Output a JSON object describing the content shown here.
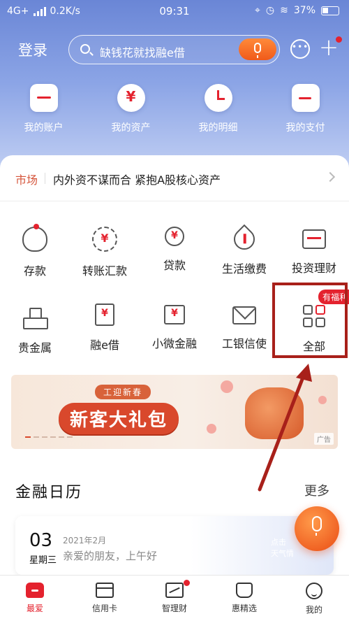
{
  "status_bar": {
    "network": "4G+",
    "speed": "0.2K/s",
    "time": "09:31",
    "battery": "37%"
  },
  "header": {
    "login_label": "登录",
    "search_placeholder": "缺钱花就找融e借"
  },
  "quick_actions": [
    {
      "label": "我的账户",
      "icon": "card-icon"
    },
    {
      "label": "我的资产",
      "icon": "yuan-coin-icon"
    },
    {
      "label": "我的明细",
      "icon": "clock-icon"
    },
    {
      "label": "我的支付",
      "icon": "wallet-icon"
    }
  ],
  "market": {
    "tag": "市场",
    "headline": "内外资不谋而合 紧抱A股核心资产"
  },
  "services": [
    {
      "label": "存款",
      "icon": "piggy-bank-icon"
    },
    {
      "label": "转账汇款",
      "icon": "transfer-icon"
    },
    {
      "label": "贷款",
      "icon": "loan-hand-icon"
    },
    {
      "label": "生活缴费",
      "icon": "utility-drop-icon"
    },
    {
      "label": "投资理财",
      "icon": "invest-chart-icon"
    },
    {
      "label": "贵金属",
      "icon": "gold-bars-icon"
    },
    {
      "label": "融e借",
      "icon": "rong-e-jie-icon"
    },
    {
      "label": "小微金融",
      "icon": "micro-finance-icon"
    },
    {
      "label": "工银信使",
      "icon": "envelope-icon"
    },
    {
      "label": "全部",
      "icon": "grid-all-icon",
      "badge": "有福利"
    }
  ],
  "banner": {
    "subtitle": "工迎新春",
    "title": "新客大礼包",
    "ad_label": "广告"
  },
  "calendar": {
    "section_title": "金融日历",
    "more_label": "更多",
    "day": "03",
    "weekday": "星期三",
    "month": "2021年2月",
    "greeting": "亲爱的朋友，上午好",
    "side_line1": "点击",
    "side_line2": "天气情"
  },
  "tabs": [
    {
      "label": "最爱",
      "active": true
    },
    {
      "label": "信用卡",
      "active": false
    },
    {
      "label": "智理财",
      "active": false,
      "dot": true
    },
    {
      "label": "惠精选",
      "active": false
    },
    {
      "label": "我的",
      "active": false
    }
  ],
  "colors": {
    "brand_red": "#e4222e",
    "accent_orange": "#f05a1a",
    "highlight_box": "#a8201a",
    "header_blue": "#6a86d6"
  }
}
